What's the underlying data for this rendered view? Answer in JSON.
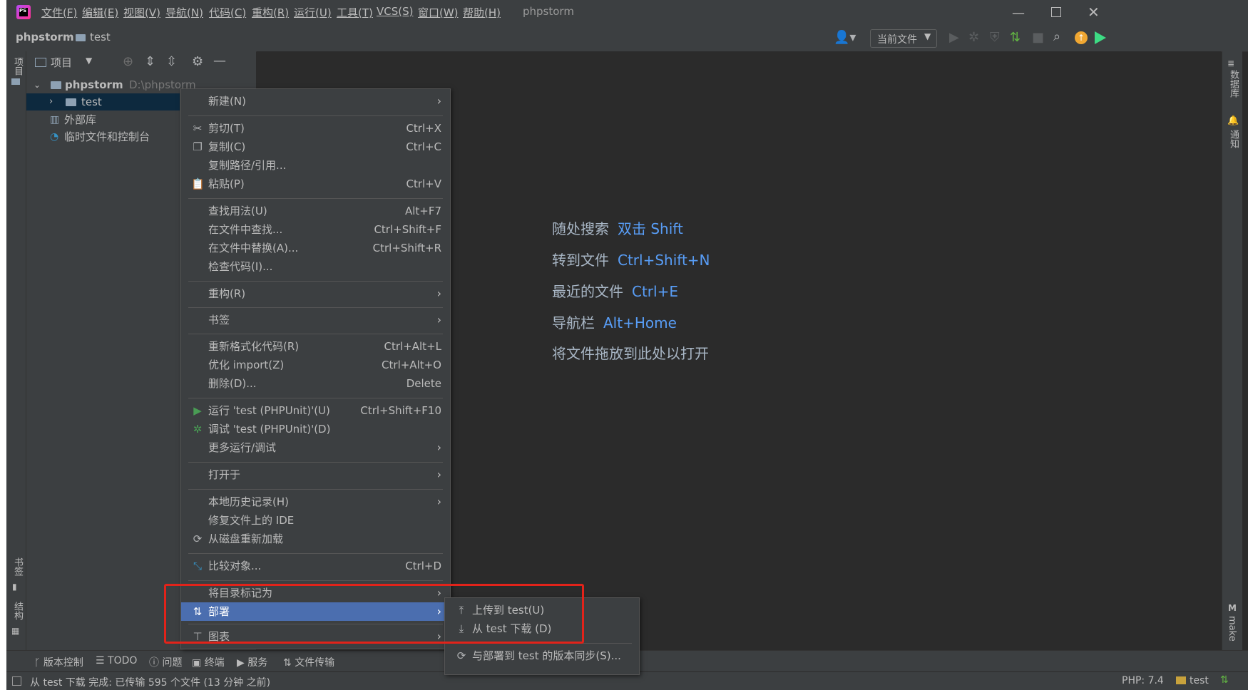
{
  "app": {
    "window_title": "phpstorm",
    "menus": [
      "文件(F)",
      "编辑(E)",
      "视图(V)",
      "导航(N)",
      "代码(C)",
      "重构(R)",
      "运行(U)",
      "工具(T)",
      "VCS(S)",
      "窗口(W)",
      "帮助(H)"
    ]
  },
  "breadcrumb": {
    "project": "phpstorm",
    "folder": "test"
  },
  "toolbar": {
    "run_config": "当前文件"
  },
  "project_panel": {
    "title": "项目",
    "root_name": "phpstorm",
    "root_path": "D:\\phpstorm",
    "items": [
      {
        "label": "test"
      },
      {
        "label": "外部库"
      },
      {
        "label": "临时文件和控制台"
      }
    ]
  },
  "left_strip": {
    "project": "项目",
    "bookmarks": "书签",
    "structure": "结构"
  },
  "right_strip": {
    "database": "数据库",
    "notifications": "通知",
    "make": "make"
  },
  "context_menu": {
    "new": "新建(N)",
    "cut": "剪切(T)",
    "cut_sc": "Ctrl+X",
    "copy": "复制(C)",
    "copy_sc": "Ctrl+C",
    "copy_path": "复制路径/引用...",
    "paste": "粘贴(P)",
    "paste_sc": "Ctrl+V",
    "find_usages": "查找用法(U)",
    "find_usages_sc": "Alt+F7",
    "find_in_files": "在文件中查找...",
    "find_in_files_sc": "Ctrl+Shift+F",
    "replace_in_files": "在文件中替换(A)...",
    "replace_in_files_sc": "Ctrl+Shift+R",
    "inspect": "检查代码(I)...",
    "refactor": "重构(R)",
    "bookmarks": "书签",
    "reformat": "重新格式化代码(R)",
    "reformat_sc": "Ctrl+Alt+L",
    "optimize_imports": "优化 import(Z)",
    "optimize_imports_sc": "Ctrl+Alt+O",
    "delete": "删除(D)...",
    "delete_sc": "Delete",
    "run": "运行 'test (PHPUnit)'(U)",
    "run_sc": "Ctrl+Shift+F10",
    "debug": "调试 'test (PHPUnit)'(D)",
    "more_run": "更多运行/调试",
    "open_in": "打开于",
    "local_history": "本地历史记录(H)",
    "repair_ide": "修复文件上的 IDE",
    "reload": "从磁盘重新加载",
    "compare": "比较对象...",
    "compare_sc": "Ctrl+D",
    "mark_dir": "将目录标记为",
    "deployment": "部署",
    "diagrams": "图表"
  },
  "submenu": {
    "upload": "上传到 test(U)",
    "download": "从 test 下载 (D)",
    "sync": "与部署到 test 的版本同步(S)..."
  },
  "editor_hints": [
    {
      "label": "随处搜索",
      "key": "双击 Shift"
    },
    {
      "label": "转到文件",
      "key": "Ctrl+Shift+N"
    },
    {
      "label": "最近的文件",
      "key": "Ctrl+E"
    },
    {
      "label": "导航栏",
      "key": "Alt+Home"
    },
    {
      "label": "将文件拖放到此处以打开",
      "key": ""
    }
  ],
  "bottom_tabs": [
    "版本控制",
    "TODO",
    "问题",
    "终端",
    "服务",
    "文件传输"
  ],
  "status": {
    "message": "从 test 下载 完成: 已传输 595 个文件 (13 分钟 之前)",
    "php": "PHP: 7.4",
    "server": "test"
  },
  "colors": {
    "menu_bg": "#3c3f41",
    "selection": "#4b6eaf",
    "highlight_box": "#e2231a",
    "shortcut_blue": "#589df6"
  }
}
